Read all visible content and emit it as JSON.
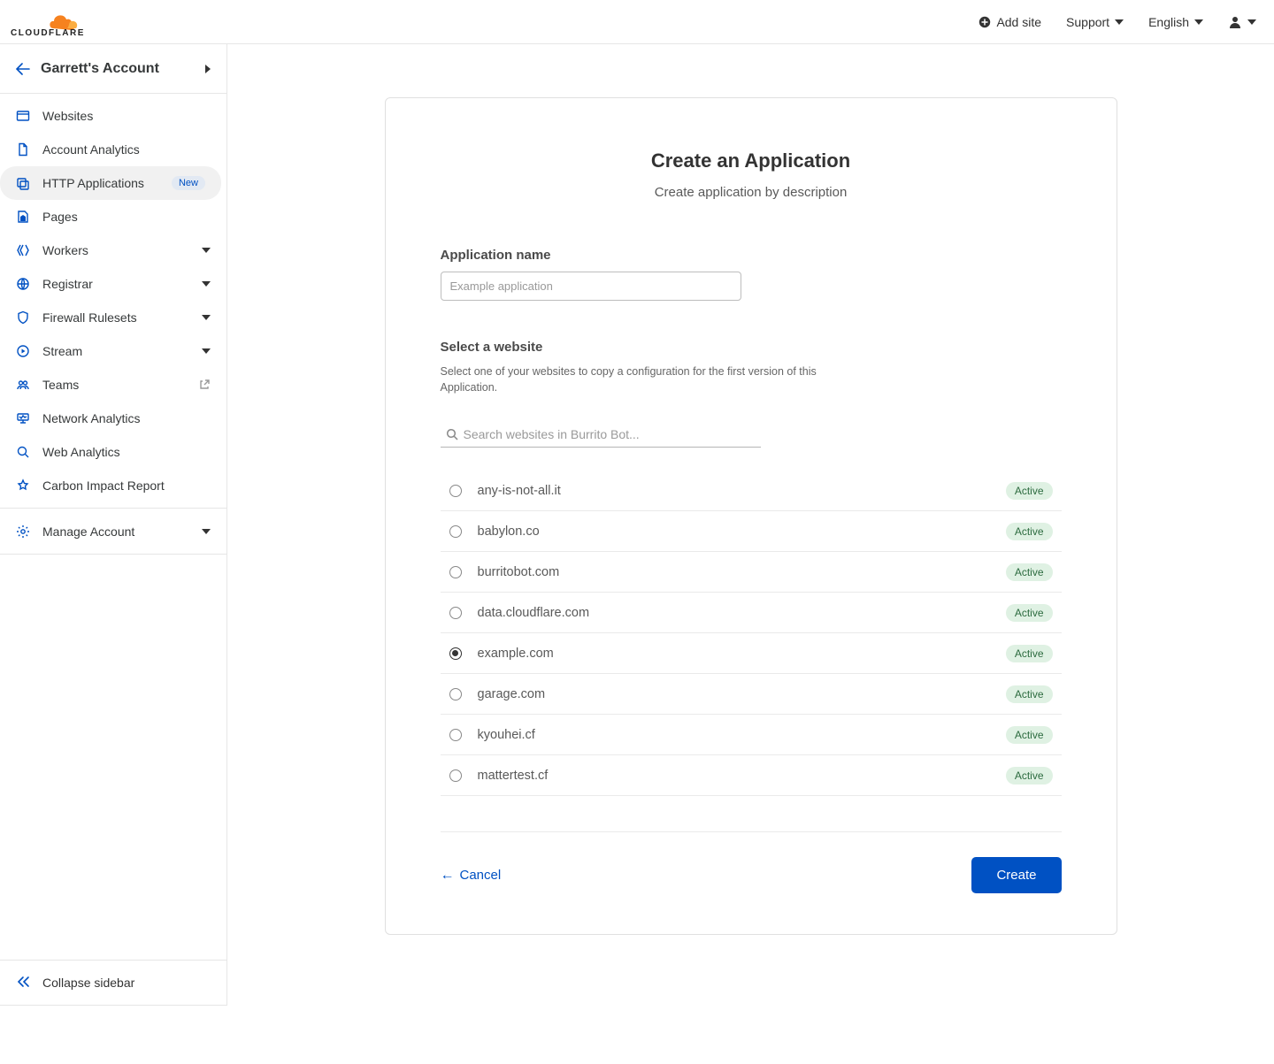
{
  "top": {
    "add_site": "Add site",
    "support": "Support",
    "language": "English"
  },
  "account": {
    "name": "Garrett's Account"
  },
  "sidebar": {
    "items": [
      {
        "label": "Websites",
        "icon": "window",
        "expandable": false
      },
      {
        "label": "Account Analytics",
        "icon": "doc",
        "expandable": false
      },
      {
        "label": "HTTP Applications",
        "icon": "stack",
        "expandable": false,
        "badge": "New",
        "active": true
      },
      {
        "label": "Pages",
        "icon": "pages",
        "expandable": false
      },
      {
        "label": "Workers",
        "icon": "workers",
        "expandable": true
      },
      {
        "label": "Registrar",
        "icon": "globe",
        "expandable": true
      },
      {
        "label": "Firewall Rulesets",
        "icon": "shield",
        "expandable": true
      },
      {
        "label": "Stream",
        "icon": "stream",
        "expandable": true
      },
      {
        "label": "Teams",
        "icon": "teams",
        "expandable": false,
        "ext": true
      },
      {
        "label": "Network Analytics",
        "icon": "network",
        "expandable": false
      },
      {
        "label": "Web Analytics",
        "icon": "search",
        "expandable": false
      },
      {
        "label": "Carbon Impact Report",
        "icon": "star",
        "expandable": false
      }
    ],
    "manage_label": "Manage Account",
    "collapse_label": "Collapse sidebar"
  },
  "main": {
    "title": "Create an Application",
    "subtitle": "Create application by description",
    "app_name_label": "Application name",
    "app_name_placeholder": "Example application",
    "select_title": "Select a website",
    "select_desc": "Select one of your websites to copy a configuration for the first version of this Application.",
    "search_placeholder": "Search websites in Burrito Bot...",
    "sites": [
      {
        "name": "any-is-not-all.it",
        "status": "Active",
        "selected": false
      },
      {
        "name": "babylon.co",
        "status": "Active",
        "selected": false
      },
      {
        "name": "burritobot.com",
        "status": "Active",
        "selected": false
      },
      {
        "name": "data.cloudflare.com",
        "status": "Active",
        "selected": false
      },
      {
        "name": "example.com",
        "status": "Active",
        "selected": true
      },
      {
        "name": "garage.com",
        "status": "Active",
        "selected": false
      },
      {
        "name": "kyouhei.cf",
        "status": "Active",
        "selected": false
      },
      {
        "name": "mattertest.cf",
        "status": "Active",
        "selected": false
      }
    ],
    "cancel_label": "Cancel",
    "create_label": "Create"
  }
}
